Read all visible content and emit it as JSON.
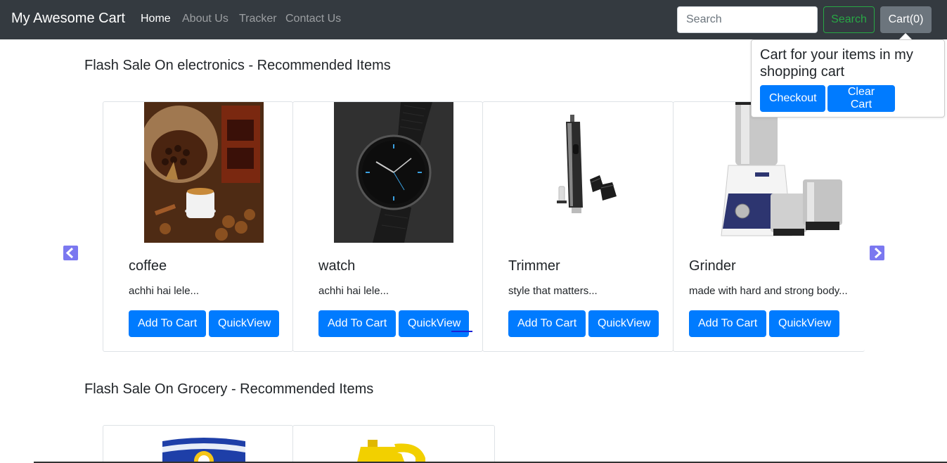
{
  "navbar": {
    "brand": "My Awesome Cart",
    "links": [
      "Home",
      "About Us",
      "Tracker",
      "Contact Us"
    ],
    "search_placeholder": "Search",
    "search_button": "Search",
    "cart_button": "Cart(0)"
  },
  "sections": [
    {
      "title": "Flash Sale On electronics - Recommended Items",
      "products": [
        {
          "name": "coffee",
          "desc": "achhi hai lele...",
          "add_label": "Add To Cart",
          "view_label": "QuickView"
        },
        {
          "name": "watch",
          "desc": "achhi hai lele...",
          "add_label": "Add To Cart",
          "view_label": "QuickView"
        },
        {
          "name": "Trimmer",
          "desc": "style that matters...",
          "add_label": "Add To Cart",
          "view_label": "QuickView"
        },
        {
          "name": "Grinder",
          "desc": "made with hard and strong body...",
          "add_label": "Add To Cart",
          "view_label": "QuickView"
        }
      ]
    },
    {
      "title": "Flash Sale On Grocery - Recommended Items"
    }
  ],
  "popover": {
    "title": "Cart for your items in my shopping cart",
    "checkout": "Checkout",
    "clear": "Clear Cart"
  },
  "colors": {
    "navbar": "#343a40",
    "primary": "#007bff",
    "success": "#28a745",
    "secondary": "#6c757d",
    "arrow": "#7b78f0"
  },
  "icons": [
    "chevron-left-icon",
    "chevron-right-icon"
  ]
}
